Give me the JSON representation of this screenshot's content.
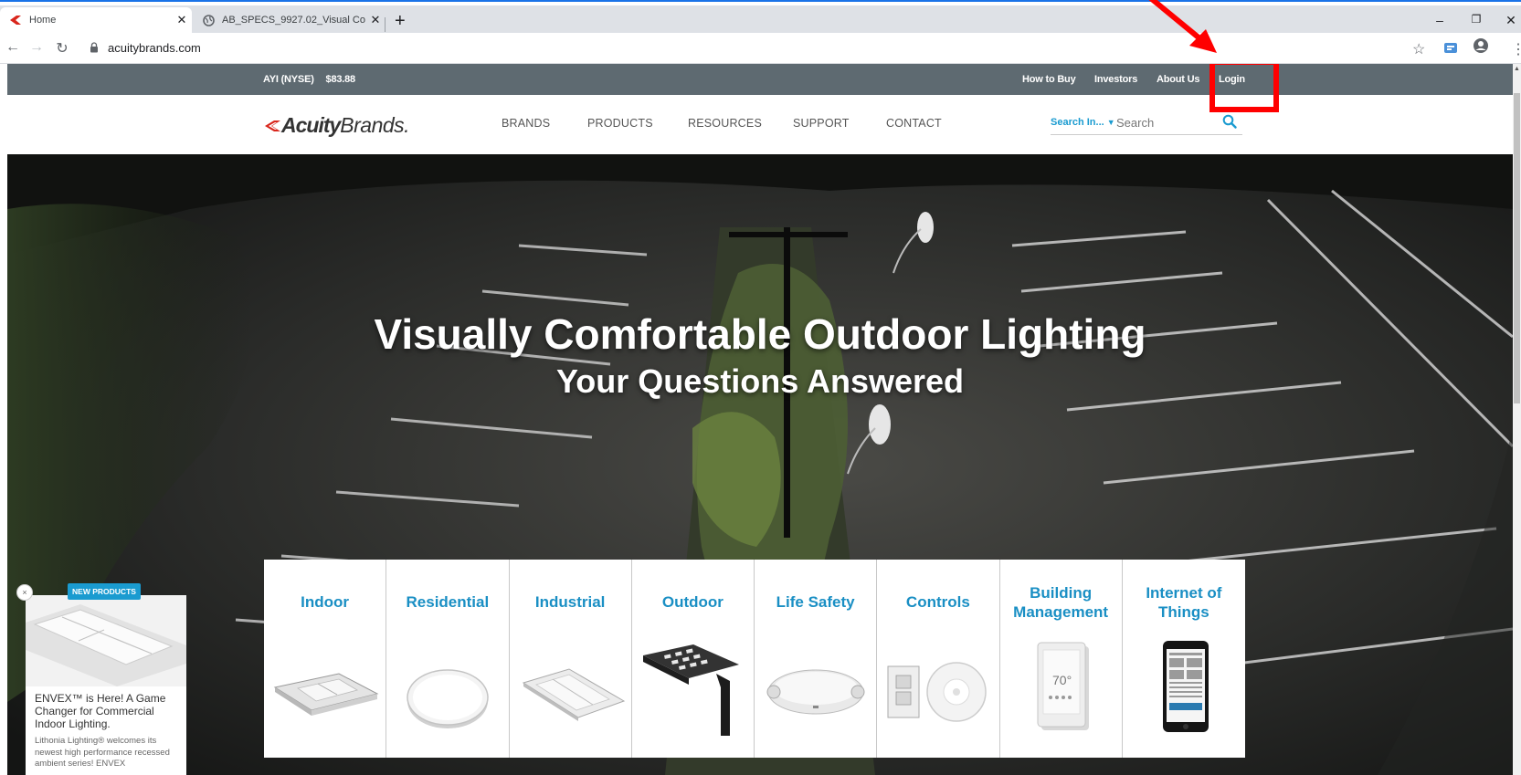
{
  "browser": {
    "tabs": [
      {
        "label": "Home",
        "icon": "acuity-favicon",
        "active": true
      },
      {
        "label": "AB_SPECS_9927.02_Visual Comfo",
        "icon": "globe-icon",
        "active": false
      }
    ],
    "url": "acuitybrands.com",
    "colors": {
      "accent": "#1a73e8"
    }
  },
  "topbar": {
    "stock_symbol": "AYI (NYSE)",
    "stock_price": "$83.88",
    "links": [
      "How to Buy",
      "Investors",
      "About Us",
      "Login"
    ],
    "colors": {
      "background": "#5e6a71"
    }
  },
  "header": {
    "logo_bold": "Acuity",
    "logo_light": "Brands.",
    "nav": [
      "BRANDS",
      "PRODUCTS",
      "RESOURCES",
      "SUPPORT",
      "CONTACT"
    ],
    "search_in_label": "Search In...",
    "search_placeholder": "Search"
  },
  "hero": {
    "title": "Visually Comfortable Outdoor Lighting",
    "subtitle": "Your Questions Answered"
  },
  "categories": [
    {
      "label": "Indoor",
      "icon": "troffer-fixture"
    },
    {
      "label": "Residential",
      "icon": "round-flush-mount"
    },
    {
      "label": "Industrial",
      "icon": "high-bay-fixture"
    },
    {
      "label": "Outdoor",
      "icon": "area-light-fixture"
    },
    {
      "label": "Life Safety",
      "icon": "emergency-light"
    },
    {
      "label": "Controls",
      "icon": "wall-switch-and-sensor"
    },
    {
      "label": "Building Management",
      "icon": "thermostat-panel"
    },
    {
      "label": "Internet of Things",
      "icon": "smartphone"
    }
  ],
  "promo": {
    "badge": "NEW PRODUCTS",
    "close": "×",
    "headline": "ENVEX™ is Here! A Game Changer for Commercial Indoor Lighting.",
    "body": "Lithonia Lighting® welcomes its newest high performance recessed ambient series! ENVEX"
  },
  "annotation": {
    "color": "#ff0000",
    "target": "Login"
  },
  "colors": {
    "brand_blue": "#1a8fc4",
    "search_blue": "#1a9bd0"
  }
}
